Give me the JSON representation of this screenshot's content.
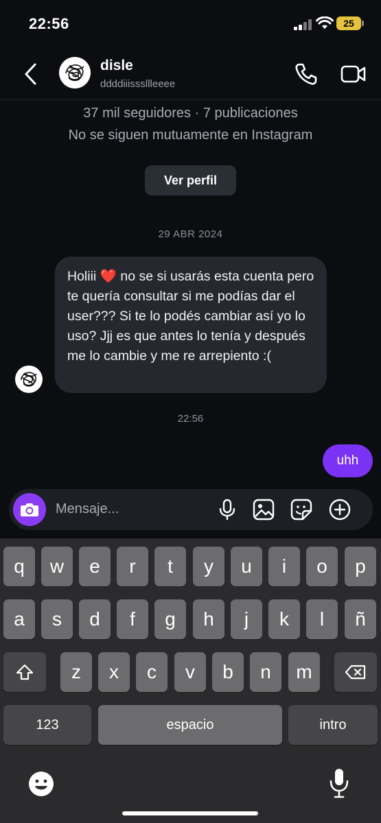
{
  "status": {
    "time": "22:56",
    "battery": "25"
  },
  "header": {
    "name": "disle",
    "username": "ddddiiisssllleeee"
  },
  "profile": {
    "followers": "37 mil seguidores · 7 publicaciones",
    "mutual": "No se siguen mutuamente en Instagram",
    "view_profile": "Ver perfil"
  },
  "chat": {
    "date": "29 ABR 2024",
    "incoming_lead": "Holiii",
    "incoming_heart": "❤️",
    "incoming_rest": " no se si usarás esta cuenta pero te quería consultar si me podías dar el user??? Si te lo podés cambiar así yo lo uso? Jjj es que antes lo tenía y después me lo cambie y me re arrepiento :(",
    "time": "22:56",
    "outgoing": "uhh"
  },
  "composer": {
    "placeholder": "Mensaje..."
  },
  "keyboard": {
    "row1": [
      "q",
      "w",
      "e",
      "r",
      "t",
      "y",
      "u",
      "i",
      "o",
      "p"
    ],
    "row2": [
      "a",
      "s",
      "d",
      "f",
      "g",
      "h",
      "j",
      "k",
      "l",
      "ñ"
    ],
    "row3": [
      "z",
      "x",
      "c",
      "v",
      "b",
      "n",
      "m"
    ],
    "numbers": "123",
    "space": "espacio",
    "return": "intro"
  },
  "colors": {
    "outgoing_bubble": "#7a33f5",
    "incoming_bubble": "#25282e",
    "camera_button": "#8a3cf5"
  }
}
